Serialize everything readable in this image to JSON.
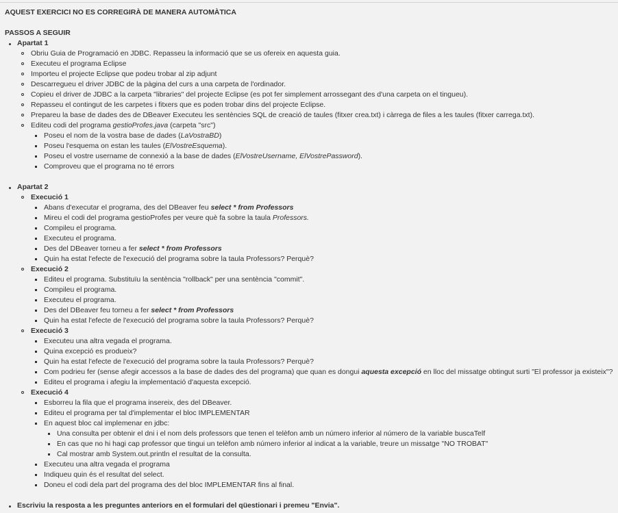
{
  "title": "AQUEST EXERCICI NO ES CORREGIRÀ DE MANERA AUTOMÀTICA",
  "steps_title": "PASSOS A SEGUIR",
  "apartat1": {
    "label": "Apartat 1",
    "items": [
      "Obriu Guia de Programació en JDBC. Repasseu la informació que se us ofereix en aquesta guia.",
      "Executeu el programa Eclipse",
      "Importeu el projecte Eclipse que podeu trobar al zip adjunt",
      "Descarregueu el driver JDBC de la pàgina del curs a una carpeta de l'ordinador.",
      "Copieu el driver de JDBC a la carpeta \"libraries\" del projecte Eclipse (es pot fer simplement arrossegant des d'una carpeta on el tingueu).",
      "Repasseu el contingut de les carpetes i fitxers que es poden trobar dins del projecte Eclipse.",
      "Prepareu la base de dades des de DBeaver Executeu les sentències SQL de creació de taules (fitxer crea.txt) i càrrega de files a les taules (fitxer carrega.txt)."
    ],
    "edit": {
      "pre": "Editeu codi del programa ",
      "file": "gestioProfes.java",
      "post": " (carpeta \"src\")"
    },
    "sub": {
      "s1_pre": "Poseu el nom de la vostra base de dades (",
      "s1_i": "LaVostraBD",
      "s1_post": ")",
      "s2_pre": "Poseu l'esquema on estan les taules (",
      "s2_i": "ElVostreEsquema",
      "s2_post": ").",
      "s3_pre": "Poseu el vostre username de connexió a la base de dades (",
      "s3_i": "ElVostreUsername, ElVostrePassword",
      "s3_post": ").",
      "s4": "Comproveu que el programa no té errors"
    }
  },
  "apartat2": {
    "label": "Apartat 2",
    "ex1": {
      "label": "Execució 1",
      "a_pre": "Abans d'executar el programa, des del DBeaver feu ",
      "a_b": "select * from Professors",
      "b_pre": "Mireu el codi del programa gestioProfes per veure què fa sobre la taula ",
      "b_i": "Professors.",
      "c": "Compileu el programa.",
      "d": "Executeu el programa.",
      "e_pre": "Des del DBeaver torneu a fer ",
      "e_b": "select * from Professors",
      "f": "Quin ha estat l'efecte de l'execució del programa sobre la taula Professors? Perquè?"
    },
    "ex2": {
      "label": "Execució 2",
      "a": "Editeu el programa. Substituïu la sentència \"rollback\" per una sentència \"commit\".",
      "b": "Compileu el programa.",
      "c": "Executeu el programa.",
      "d_pre": "Des del DBeaver feu torneu a fer ",
      "d_b": "select * from Professors",
      "e": "Quin ha estat l'efecte de l'execució del programa sobre la taula Professors? Perquè?"
    },
    "ex3": {
      "label": "Execució 3",
      "a": "Executeu una altra vegada el programa.",
      "b": "Quina excepció es produeix?",
      "c": "Quin ha estat l'efecte de l'execució del programa sobre la taula Professors? Perquè?",
      "d_pre": "Com podrieu fer (sense afegir accessos a la base de dades des del programa) que quan es dongui ",
      "d_b": "aquesta excepció",
      "d_post": " en lloc del missatge obtingut surti \"El professor ja existeix\"?",
      "e": "Editeu el programa i afegiu la implementació d'aquesta excepció."
    },
    "ex4": {
      "label": "Execució 4",
      "a": "Esborreu la fila que el programa insereix, des del DBeaver.",
      "b": "Editeu el programa per tal d'implementar el bloc IMPLEMENTAR",
      "c": "En aquest bloc cal implemenar en jdbc:",
      "c1": "Una consulta per obtenir el dni i el nom dels professors que tenen el telèfon amb un número inferior al número de la variable buscaTelf",
      "c2": "En cas que no hi hagi cap professor que tingui un telèfon amb número inferior al indicat a la variable, treure un missatge \"NO TROBAT\"",
      "c3": "Cal mostrar amb System.out.println el resultat de la consulta.",
      "d": "Executeu una altra vegada el programa",
      "e": "Indiqueu quin és el resultat del select.",
      "f": "Doneu el codi dela part del programa des del bloc IMPLEMENTAR fins al final."
    }
  },
  "final": "Escriviu la resposta a les preguntes anteriors en el formulari del qüestionari i premeu \"Envia\"."
}
